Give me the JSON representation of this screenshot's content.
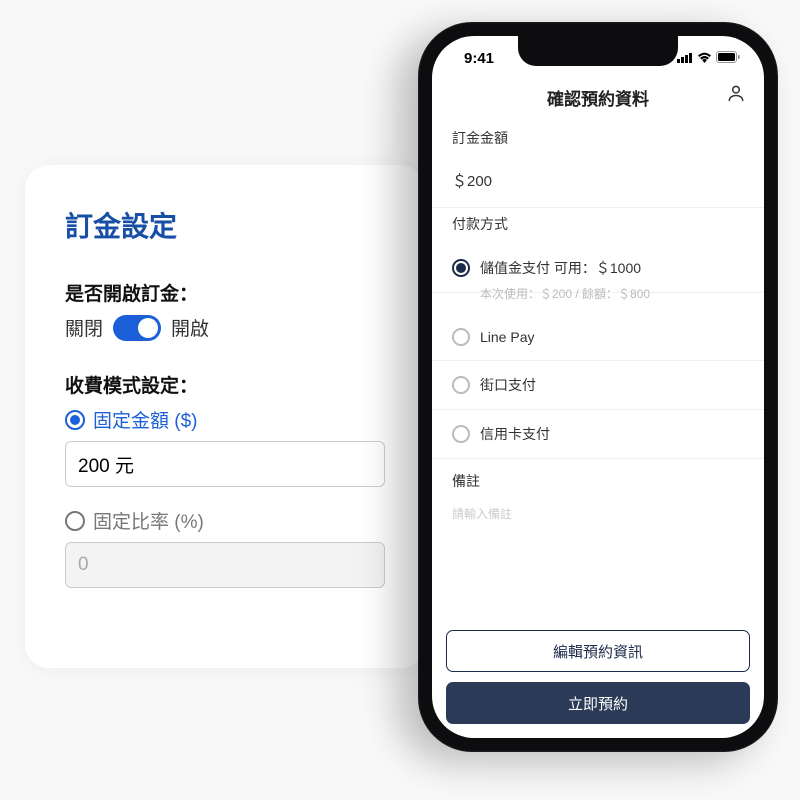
{
  "card": {
    "title": "訂金設定",
    "enable_label": "是否開啟訂金：",
    "toggle_off": "關閉",
    "toggle_on": "開啟",
    "mode_label": "收費模式設定：",
    "fixed_amount_label": "固定金額 ($)",
    "fixed_amount_value": "200 元",
    "fixed_percent_label": "固定比率 (%)",
    "fixed_percent_value": "0"
  },
  "phone": {
    "time": "9:41",
    "title": "確認預約資料",
    "deposit_label": "訂金金額",
    "deposit_value": "＄200",
    "pay_label": "付款方式",
    "pay_options": [
      {
        "label": "儲值金支付 可用：＄1000",
        "selected": true,
        "sub": "本次使用：＄200 / 餘額：＄800"
      },
      {
        "label": "Line Pay",
        "selected": false
      },
      {
        "label": "街口支付",
        "selected": false
      },
      {
        "label": "信用卡支付",
        "selected": false
      }
    ],
    "remark_label": "備註",
    "remark_placeholder": "請輸入備註",
    "edit_btn": "編輯預約資訊",
    "submit_btn": "立即預約"
  }
}
